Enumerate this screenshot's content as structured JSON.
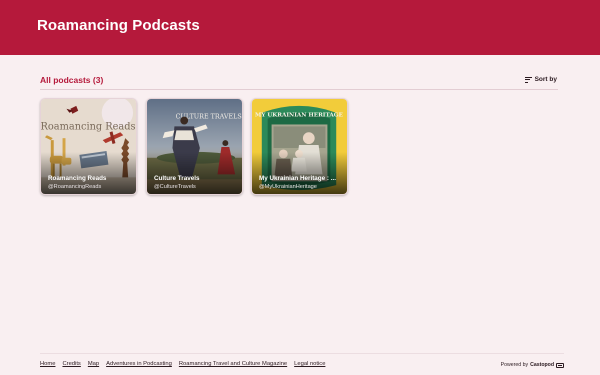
{
  "header": {
    "title": "Roamancing Podcasts"
  },
  "section": {
    "title": "All podcasts (3)",
    "sort_label": "Sort by"
  },
  "podcasts": [
    {
      "title": "Roamancing Reads",
      "handle": "@RoamancingReads",
      "cover_text": "Roamancing Reads",
      "cover_icon": "book-giraffe-plane-art"
    },
    {
      "title": "Culture Travels",
      "handle": "@CultureTravels",
      "cover_text": "CULTURE TRAVELS",
      "cover_icon": "dancers-photo"
    },
    {
      "title": "My Ukrainian Heritage : ...",
      "handle": "@MyUkrainianHeritage",
      "cover_text": "MY UKRAINIAN HERITAGE",
      "cover_icon": "family-photo"
    }
  ],
  "footer": {
    "links": [
      "Home",
      "Credits",
      "Map",
      "Adventures in Podcasting",
      "Roamancing Travel and Culture Magazine",
      "Legal notice"
    ],
    "powered_prefix": "Powered by",
    "powered_brand": "Castopod"
  },
  "colors": {
    "brand": "#b5193b",
    "background": "#f9eff1"
  }
}
